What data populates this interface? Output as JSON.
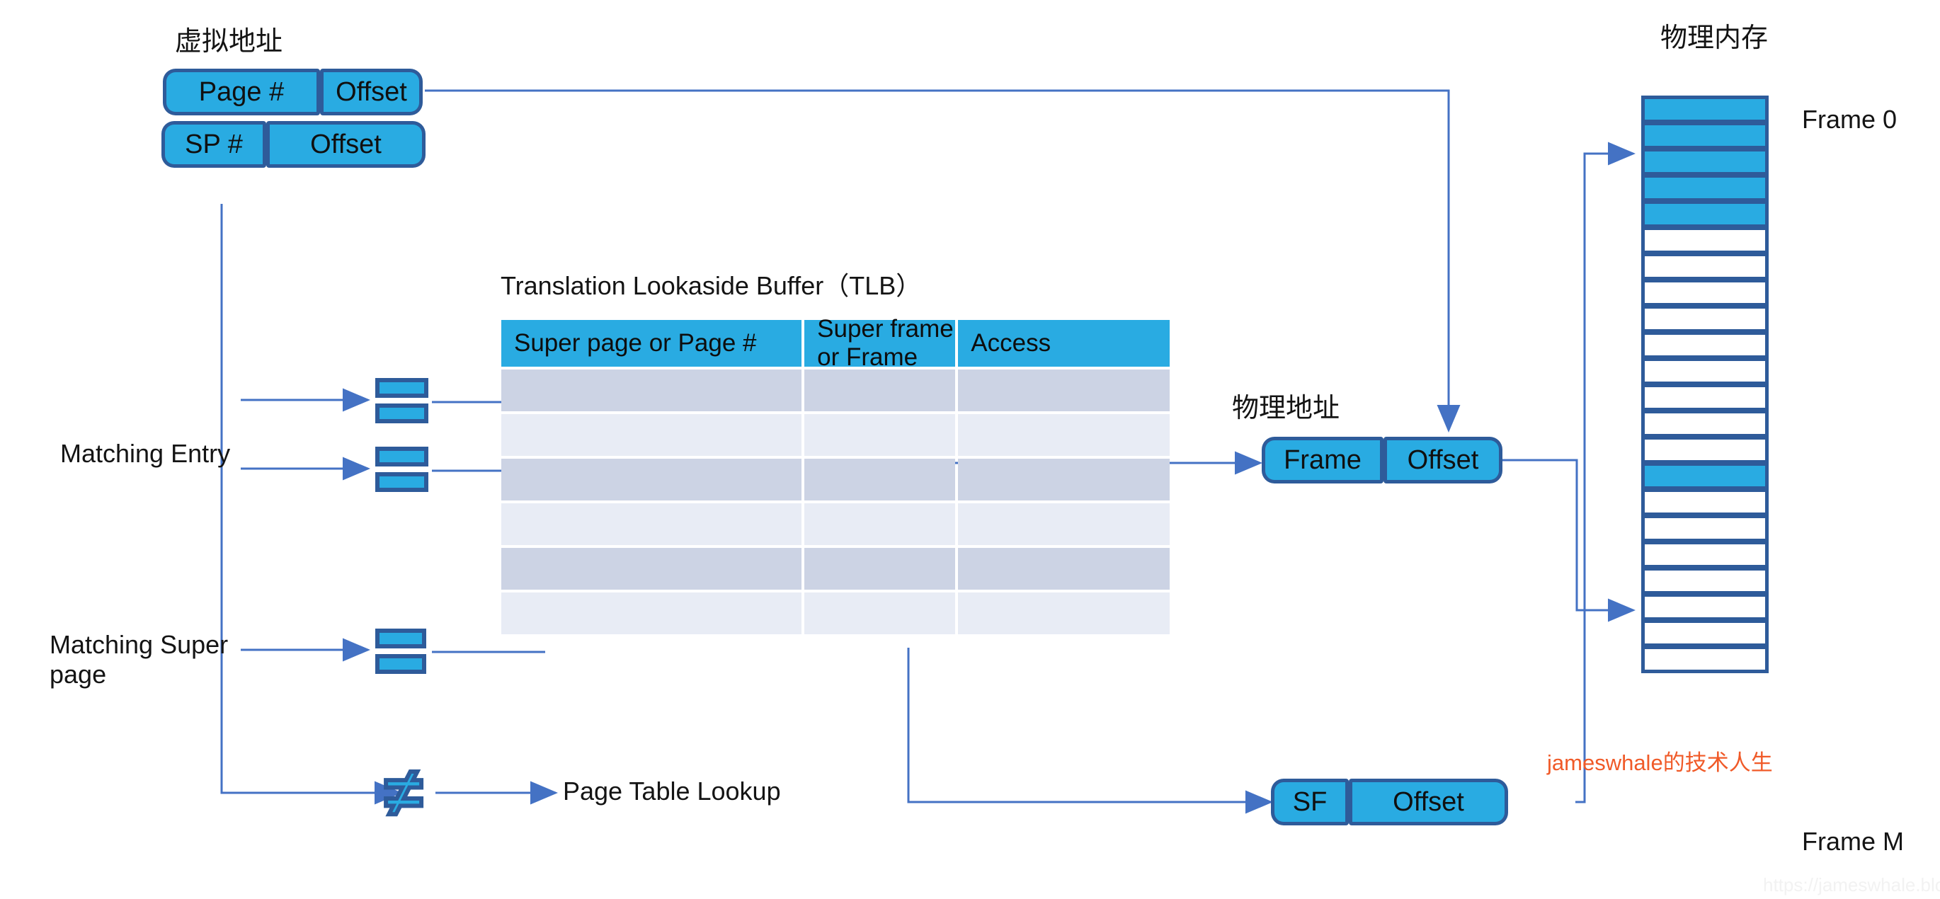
{
  "labels": {
    "virtual_address": "虚拟地址",
    "physical_memory": "物理内存",
    "physical_address": "物理地址",
    "tlb_title": "Translation Lookaside Buffer（TLB）",
    "matching_entry": "Matching Entry",
    "matching_super_page_line1": "Matching Super",
    "matching_super_page_line2": "page",
    "page_table_lookup": "Page Table Lookup",
    "frame_first": "Frame 0",
    "frame_last": "Frame M"
  },
  "virtual_address": {
    "row1": [
      {
        "text": "Page #"
      },
      {
        "text": "Offset"
      }
    ],
    "row2": [
      {
        "text": "SP #"
      },
      {
        "text": "Offset"
      }
    ]
  },
  "physical_address": {
    "hit": [
      {
        "text": "Frame"
      },
      {
        "text": "Offset"
      }
    ],
    "super": [
      {
        "text": "SF"
      },
      {
        "text": "Offset"
      }
    ]
  },
  "tlb": {
    "columns": [
      "Super page or Page #",
      "Super frame or  Frame",
      "Access"
    ],
    "rows": [
      {
        "shade": "A",
        "cells": [
          "",
          "",
          ""
        ]
      },
      {
        "shade": "B",
        "cells": [
          "",
          "",
          ""
        ]
      },
      {
        "shade": "A",
        "cells": [
          "",
          "",
          ""
        ]
      },
      {
        "shade": "B",
        "cells": [
          "",
          "",
          ""
        ]
      },
      {
        "shade": "A",
        "cells": [
          "",
          "",
          ""
        ]
      },
      {
        "shade": "B",
        "cells": [
          "",
          "",
          ""
        ]
      }
    ]
  },
  "memory": {
    "cells": [
      {
        "filled": true
      },
      {
        "filled": true
      },
      {
        "filled": true
      },
      {
        "filled": true
      },
      {
        "filled": true
      },
      {
        "filled": false
      },
      {
        "filled": false
      },
      {
        "filled": false
      },
      {
        "filled": false
      },
      {
        "filled": false
      },
      {
        "filled": false
      },
      {
        "filled": false
      },
      {
        "filled": false
      },
      {
        "filled": false
      },
      {
        "filled": true
      },
      {
        "filled": false
      },
      {
        "filled": false
      },
      {
        "filled": false
      },
      {
        "filled": false
      },
      {
        "filled": false
      },
      {
        "filled": false
      },
      {
        "filled": false
      }
    ]
  },
  "icons": {
    "mismatch_symbol": "≠"
  },
  "watermarks": {
    "primary": "jameswhale的技术人生",
    "footer": "https://jameswhale.blog.csdn.net"
  },
  "colors": {
    "block_fill": "#29abe2",
    "block_stroke": "#2e5b9a",
    "wire": "#4472c4",
    "table_row_dark": "#ccd3e4",
    "table_row_light": "#e8ecf5",
    "watermark": "#f05a28"
  }
}
